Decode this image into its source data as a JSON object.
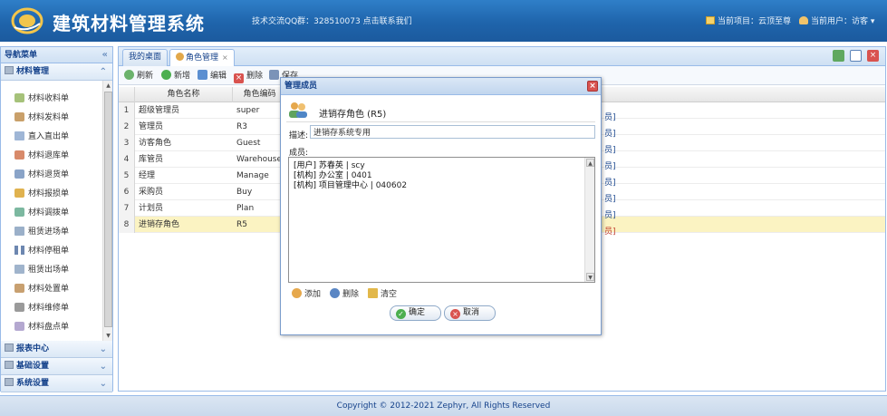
{
  "header": {
    "title": "建筑材料管理系统",
    "qq_text": "技术交流QQ群：328510073 点击联系我们",
    "current_project": "当前项目：云顶至尊",
    "current_user": "当前用户：访客"
  },
  "nav": {
    "title": "导航菜单",
    "collapse": "«",
    "active_group": "材料管理",
    "items": [
      "材料收料单",
      "材料发料单",
      "直入直出单",
      "材料退库单",
      "材料退货单",
      "材料报损单",
      "材料调拨单",
      "租赁进场单",
      "材料停租单",
      "租赁出场单",
      "材料处置单",
      "材料维修单",
      "材料盘点单"
    ],
    "groups_bottom": [
      "报表中心",
      "基础设置",
      "系统设置"
    ]
  },
  "tabs": {
    "tab1": "我的桌面",
    "tab2": "角色管理",
    "tab2_close": "×"
  },
  "toolbar": {
    "refresh": "刷新",
    "add": "新增",
    "edit": "编辑",
    "delete": "删除",
    "save": "保存"
  },
  "grid": {
    "columns": [
      "角色名称",
      "角色编码"
    ],
    "rows": [
      {
        "n": "1",
        "name": "超级管理员",
        "code": "super"
      },
      {
        "n": "2",
        "name": "管理员",
        "code": "R3"
      },
      {
        "n": "3",
        "name": "访客角色",
        "code": "Guest"
      },
      {
        "n": "4",
        "name": "库管员",
        "code": "Warehouse"
      },
      {
        "n": "5",
        "name": "经理",
        "code": "Manage"
      },
      {
        "n": "6",
        "name": "采购员",
        "code": "Buy"
      },
      {
        "n": "7",
        "name": "计划员",
        "code": "Plan"
      },
      {
        "n": "8",
        "name": "进销存角色",
        "code": "R5"
      }
    ],
    "edge_link": "员]"
  },
  "dialog": {
    "title": "管理成员",
    "close": "×",
    "role_title": "进销存角色 (R5)",
    "desc_label": "描述:",
    "desc_value": "进销存系统专用",
    "members_label": "成员:",
    "members": [
      {
        "type": "[用户]",
        "name": "苏春英",
        "sep": " | ",
        "code": "scy"
      },
      {
        "type": "[机构]",
        "name": "办公室",
        "sep": " | ",
        "code": "0401"
      },
      {
        "type": "[机构]",
        "name": "项目管理中心",
        "sep": " | ",
        "code": "040602"
      }
    ],
    "add": "添加",
    "remove": "删除",
    "clear": "清空",
    "ok": "确定",
    "cancel": "取消"
  },
  "footer": {
    "copyright": "Copyright © 2012-2021 Zephyr, All Rights Reserved"
  },
  "colors": {
    "header_blue": "#1f64ab",
    "panel_border": "#99bbe8",
    "selected_row": "#fbf3c2",
    "title_text": "#15428b"
  }
}
